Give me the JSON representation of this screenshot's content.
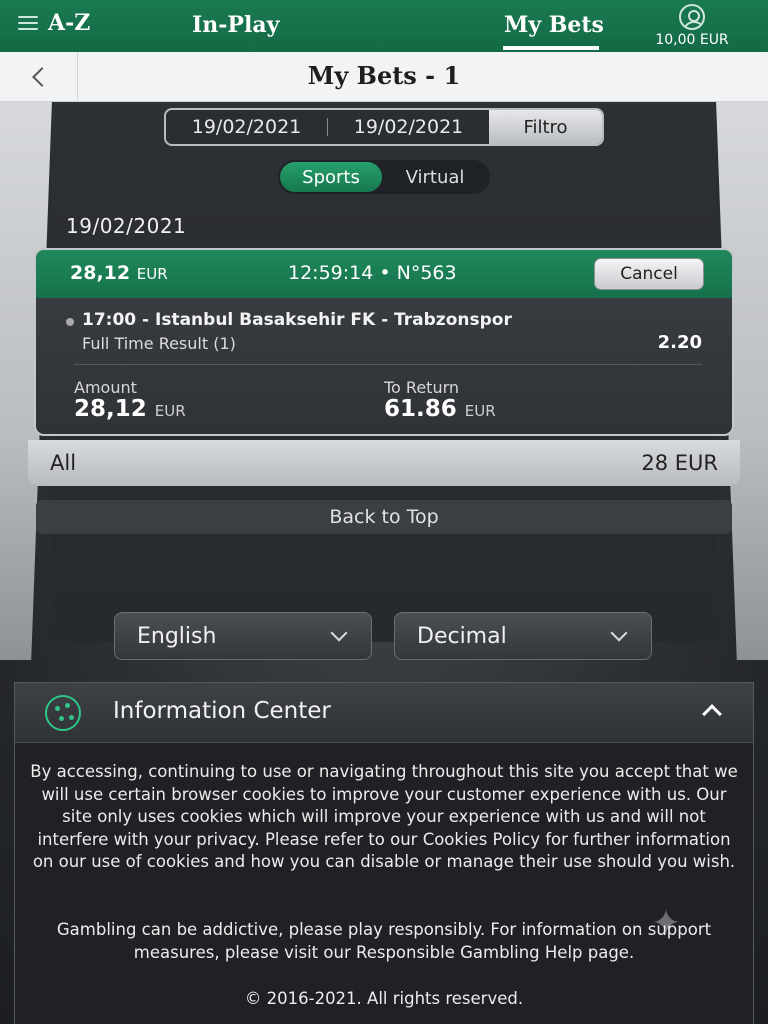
{
  "nav": {
    "az_label": "A-Z",
    "inplay_label": "In-Play",
    "mybets_label": "My Bets",
    "balance": "10,00 EUR"
  },
  "header": {
    "title": "My Bets - 1"
  },
  "filter": {
    "date_from": "19/02/2021",
    "date_to": "19/02/2021",
    "filter_label": "Filtro"
  },
  "tabs": {
    "sports_label": "Sports",
    "virtual_label": "Virtual",
    "active": "Sports"
  },
  "bets": {
    "date_heading": "19/02/2021",
    "card": {
      "stake": "28,12",
      "stake_currency": "EUR",
      "time_ref": "12:59:14 • N°563",
      "cancel_label": "Cancel",
      "event": "17:00 - Istanbul Basaksehir FK - Trabzonspor",
      "market": "Full Time Result (1)",
      "odds": "2.20",
      "amount_label": "Amount",
      "amount_value": "28,12",
      "amount_currency": "EUR",
      "return_label": "To Return",
      "return_value": "61.86",
      "return_currency": "EUR"
    },
    "all_label": "All",
    "all_total": "28 EUR"
  },
  "back_to_top_label": "Back to Top",
  "settings": {
    "language": "English",
    "odds_format": "Decimal"
  },
  "info_center": {
    "title": "Information Center",
    "cookies_text": "By accessing, continuing to use or navigating throughout this site you accept that we will use certain browser cookies to improve your customer experience with us. Our site only uses cookies which will improve your experience with us and will not interfere with your privacy. Please refer to our Cookies Policy for further information on our use of cookies and how you can disable or manage their use should you wish.",
    "gambling_text": "Gambling can be addictive, please play responsibly. For information on support measures, please visit our Responsible Gambling Help page.",
    "copyright": "© 2016-2021. All rights reserved."
  },
  "colors": {
    "brand_green": "#1a7a52",
    "accent_green": "#2fc588",
    "panel_dark": "#2d3034"
  }
}
